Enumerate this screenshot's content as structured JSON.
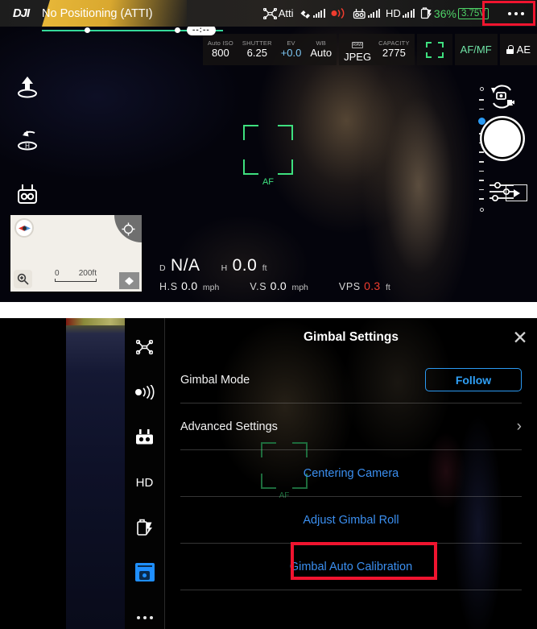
{
  "top_panel": {
    "brand": "DJI",
    "flight_mode": "No Positioning (ATTI)",
    "flight_time": "--:--",
    "status": {
      "attitude_label": "Atti",
      "battery_percent": "36%",
      "voltage": "3.75V",
      "hd_label": "HD",
      "colors": {
        "battery_green": "#4fd468",
        "rc_signal_red": "#f03c2e",
        "highlight_red": "#f0142f"
      }
    },
    "camera_params": {
      "iso_label": "Auto ISO",
      "iso_value": "800",
      "shutter_label": "SHUTTER",
      "shutter_value": "6.25",
      "ev_label": "EV",
      "ev_value": "+0.0",
      "wb_label": "WB",
      "wb_value": "Auto",
      "format_icon_label": "RAW",
      "format_value": "JPEG",
      "capacity_label": "CAPACITY",
      "capacity_value": "2775",
      "focus_mode": "AF/MF",
      "exposure_lock": "AE"
    },
    "reticle_label": "AF",
    "telemetry": {
      "distance_prefix": "D",
      "distance_value": "N/A",
      "height_prefix": "H",
      "height_value": "0.0",
      "height_unit": "ft",
      "hspeed_label": "H.S",
      "hspeed_value": "0.0",
      "hspeed_unit": "mph",
      "vspeed_label": "V.S",
      "vspeed_value": "0.0",
      "vspeed_unit": "mph",
      "vps_label": "VPS",
      "vps_value": "0.3",
      "vps_unit": "ft"
    },
    "minimap": {
      "scale_min": "0",
      "scale_max": "200ft"
    },
    "left_tools": [
      {
        "name": "takeoff",
        "icon": "takeoff-icon"
      },
      {
        "name": "return-home",
        "icon": "return-to-home-icon"
      },
      {
        "name": "remote-controller",
        "icon": "remote-controller-icon"
      }
    ]
  },
  "bottom_panel": {
    "sidebar": [
      {
        "label": "Aircraft",
        "icon": "aircraft-icon"
      },
      {
        "label": "Signal",
        "icon": "signal-icon"
      },
      {
        "label": "Remote Controller",
        "icon": "remote-controller-icon"
      },
      {
        "label": "HD",
        "icon": "hd-label"
      },
      {
        "label": "Battery",
        "icon": "battery-icon"
      },
      {
        "label": "Gimbal",
        "icon": "gimbal-icon"
      },
      {
        "label": "More",
        "icon": "more-dots-icon"
      }
    ],
    "panel": {
      "title": "Gimbal Settings",
      "close_label": "✕",
      "gimbal_mode_label": "Gimbal Mode",
      "gimbal_mode_value": "Follow",
      "advanced_label": "Advanced Settings",
      "advanced_chevron": "›",
      "centering_camera": "Centering Camera",
      "adjust_gimbal_roll": "Adjust Gimbal Roll",
      "gimbal_auto_calibration": "Gimbal Auto Calibration",
      "ghost_af_label": "AF"
    }
  }
}
